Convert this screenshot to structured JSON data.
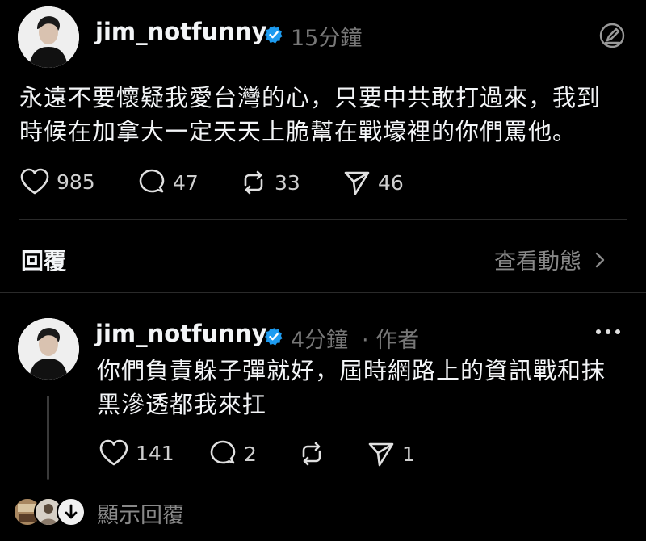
{
  "post": {
    "username": "jim_notfunny",
    "time": "15分鐘",
    "text_line1": "永遠不要懷疑我愛台灣的心，只要中共敢打過來，我到",
    "text_line2": "時候在加拿大一定天天上脆幫在戰壕裡的你們罵他。",
    "likes": "985",
    "comments": "47",
    "reposts": "33",
    "shares": "46"
  },
  "replies_header": {
    "title": "回覆",
    "activity_label": "查看動態"
  },
  "reply": {
    "username": "jim_notfunny",
    "time": "4分鐘",
    "author_tag": "· 作者",
    "text_line1": "你們負責躲子彈就好，屆時網路上的資訊戰和抹",
    "text_line2": "黑滲透都我來扛",
    "likes": "141",
    "comments": "2",
    "shares": "1"
  },
  "footer": {
    "show_replies_label": "顯示回覆"
  },
  "colors": {
    "background": "#000000",
    "verified_blue": "#1d9bf0",
    "muted_text": "#777777"
  }
}
